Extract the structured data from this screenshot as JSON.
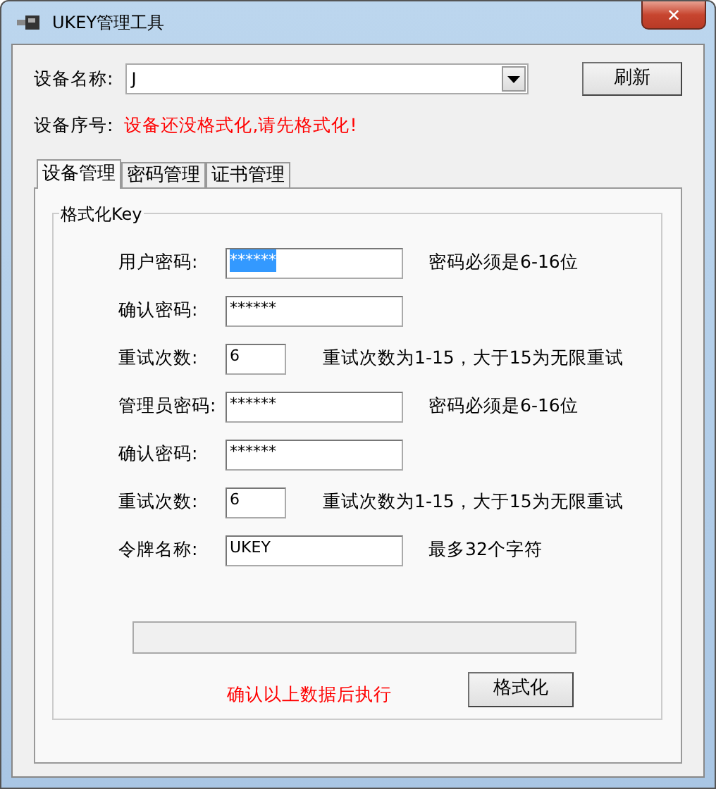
{
  "window": {
    "title": "UKEY管理工具",
    "close": "✕"
  },
  "device_name": {
    "label": "设备名称:",
    "value": "J"
  },
  "refresh_button": "刷新",
  "serial": {
    "label": "设备序号:",
    "value": "设备还没格式化,请先格式化!"
  },
  "tabs": [
    {
      "label": "设备管理",
      "selected": true
    },
    {
      "label": "密码管理",
      "selected": false
    },
    {
      "label": "证书管理",
      "selected": false
    }
  ],
  "group": {
    "title": "格式化Key"
  },
  "fields": [
    {
      "kind": "wide",
      "label": "用户密码:",
      "value": "******",
      "selected": true,
      "hint": "密码必须是6-16位"
    },
    {
      "kind": "wide",
      "label": "确认密码:",
      "value": "******",
      "selected": false
    },
    {
      "kind": "short",
      "label": "重试次数:",
      "value": "6",
      "selected": false,
      "hint": "重试次数为1-15，大于15为无限重试"
    },
    {
      "kind": "wide",
      "label": "管理员密码:",
      "value": "******",
      "selected": false,
      "hint": "密码必须是6-16位"
    },
    {
      "kind": "wide",
      "label": "确认密码:",
      "value": "******",
      "selected": false
    },
    {
      "kind": "short",
      "label": "重试次数:",
      "value": "6",
      "selected": false,
      "hint": "重试次数为1-15，大于15为无限重试"
    },
    {
      "kind": "wide",
      "label": "令牌名称:",
      "value": "UKEY",
      "selected": false,
      "hint": "最多32个字符"
    }
  ],
  "progress": {
    "level": 0
  },
  "confirm_text": "确认以上数据后执行",
  "format_button": "格式化"
}
